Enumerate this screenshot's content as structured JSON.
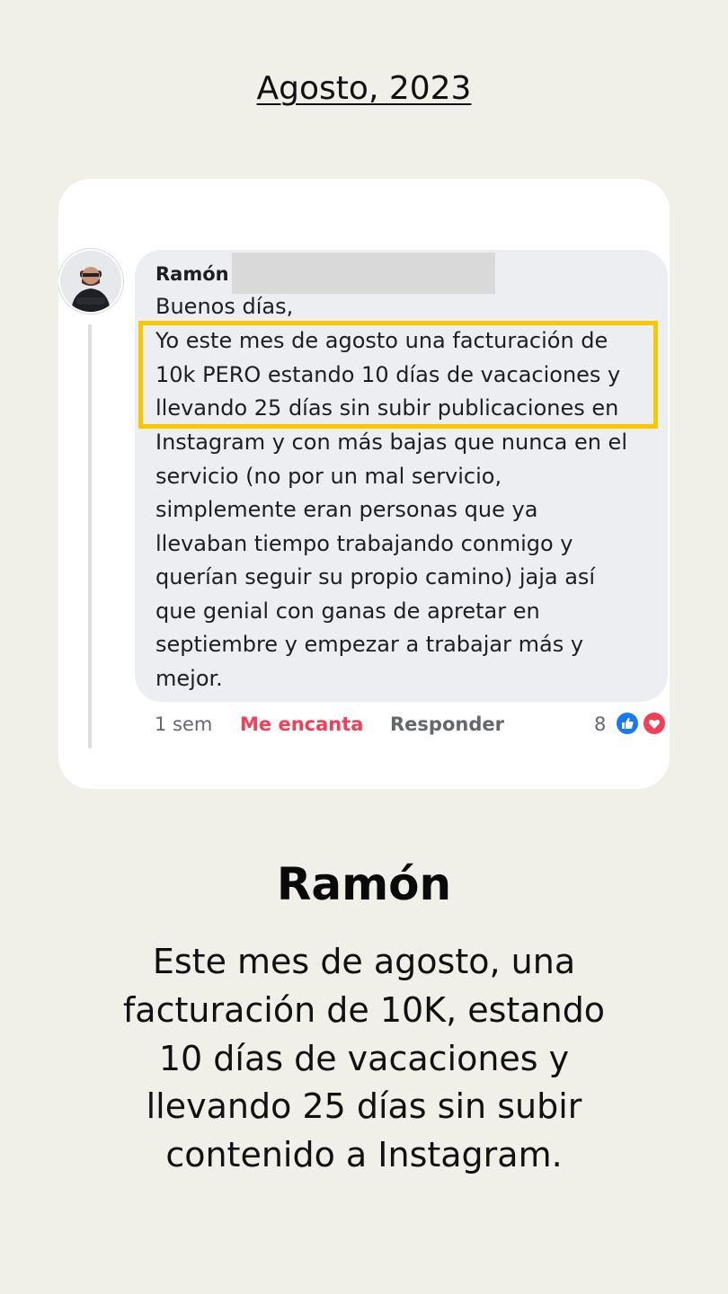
{
  "date_heading": "Agosto, 2023",
  "comment": {
    "author": "Ramón",
    "lines": [
      "Buenos días,",
      "Yo este mes de agosto una facturación de",
      "10k PERO estando 10 días de vacaciones y",
      "llevando 25 días sin subir publicaciones en",
      "Instagram y con más bajas que nunca en el",
      "servicio (no por un mal servicio,",
      "simplemente eran personas que ya",
      "llevaban tiempo trabajando conmigo y",
      "querían seguir su propio camino) jaja así",
      "que genial con ganas de apretar en",
      "septiembre y empezar a trabajar más y",
      "mejor."
    ],
    "time": "1 sem",
    "love_label": "Me encanta",
    "reply_label": "Responder",
    "reaction_count": "8",
    "reaction_icons": [
      "like-icon",
      "love-icon"
    ],
    "highlight_color": "#f7c800"
  },
  "testimonial": {
    "name": "Ramón",
    "summary_lines": [
      "Este mes de agosto, una",
      "facturación de 10K, estando",
      "10 días de vacaciones y",
      "llevando 25 días sin subir",
      "contenido a Instagram."
    ]
  },
  "colors": {
    "background": "#f0f0e9",
    "card": "#ffffff",
    "bubble": "#eceef2",
    "love_accent": "#f33e58",
    "like_blue": "#1877f2"
  }
}
